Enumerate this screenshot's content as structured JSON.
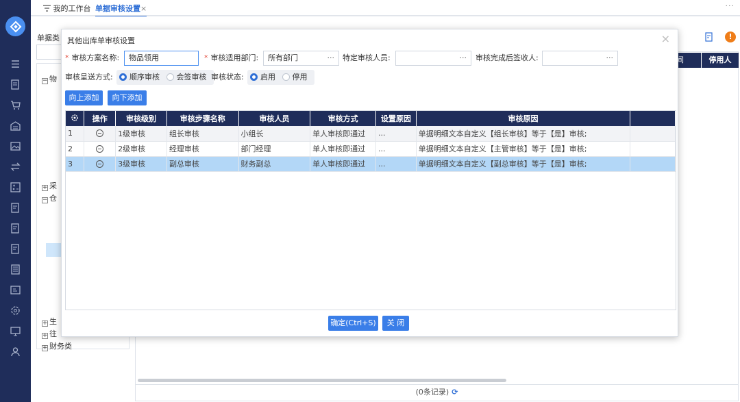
{
  "tabs": [
    {
      "label": "我的工作台"
    },
    {
      "label": "单据审核设置",
      "close": "×"
    }
  ],
  "topbar_more": "···",
  "background": {
    "doc_type_label": "单据类",
    "tree_nodes": [
      {
        "label": "物",
        "expanded": true
      },
      {
        "label": "采",
        "expanded": false
      },
      {
        "label": "仓",
        "expanded": true
      },
      {
        "label": "生",
        "expanded": false
      },
      {
        "label": "往",
        "expanded": false
      },
      {
        "label": "财务类",
        "expanded": false
      }
    ],
    "grid_header_col": "停用人",
    "grid_header_partial": "间",
    "records_text": "(0条记录)"
  },
  "modal": {
    "title": "其他出库单审核设置",
    "close": "×",
    "scheme_name_label": "审核方案名称:",
    "scheme_name_value": "物品领用",
    "dept_label": "审核适用部门:",
    "dept_value": "所有部门",
    "reviewer_label": "特定审核人员:",
    "receiver_label": "审核完成后签收人:",
    "ellipsis": "···",
    "send_mode_label": "审核呈送方式:",
    "send_mode_options": [
      "顺序审核",
      "会签审核"
    ],
    "send_mode_selected": "顺序审核",
    "status_label": "审核状态:",
    "status_options": [
      "启用",
      "停用"
    ],
    "status_selected": "启用",
    "btn_add_up": "向上添加",
    "btn_add_down": "向下添加",
    "btn_confirm": "确定(Ctrl+S)",
    "btn_close": "关 闭",
    "table": {
      "headers": [
        "操作",
        "审核级别",
        "审核步骤名称",
        "审核人员",
        "审核方式",
        "设置原因",
        "审核原因"
      ],
      "rows": [
        {
          "no": "1",
          "level": "1级审核",
          "step": "组长审核",
          "person": "小组长",
          "mode": "单人审核即通过",
          "reason_set": "...",
          "reason": "单据明细文本自定义【组长审核】等于【是】审核;"
        },
        {
          "no": "2",
          "level": "2级审核",
          "step": "经理审核",
          "person": "部门经理",
          "mode": "单人审核即通过",
          "reason_set": "...",
          "reason": "单据明细文本自定义【主管审核】等于【是】审核;"
        },
        {
          "no": "3",
          "level": "3级审核",
          "step": "副总审核",
          "person": "财务副总",
          "mode": "单人审核即通过",
          "reason_set": "...",
          "reason": "单据明细文本自定义【副总审核】等于【是】审核;"
        }
      ],
      "selected_row": 3
    }
  },
  "colors": {
    "rail": "#1f2d5a",
    "accent": "#3a7ee8",
    "selected_row": "#b3d7f7",
    "warning": "#ef7d19"
  }
}
